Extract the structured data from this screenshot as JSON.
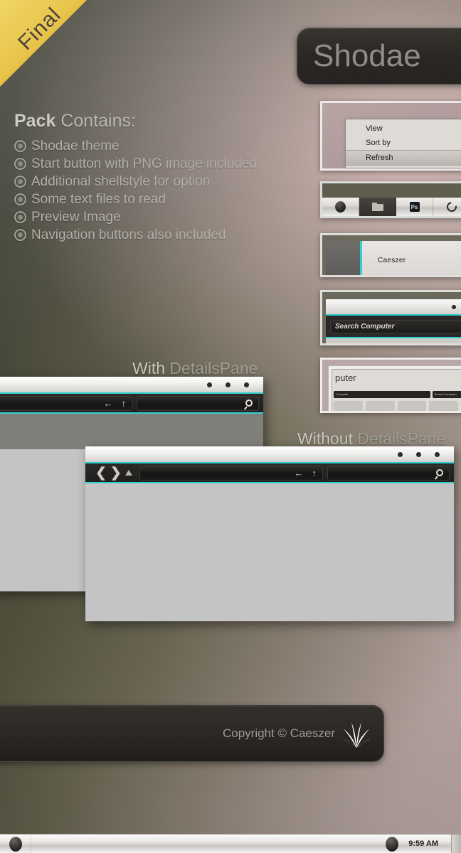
{
  "ribbon": {
    "label": "Final",
    "color": "#e8c54a"
  },
  "title_panel": {
    "text": "Shodae"
  },
  "pack": {
    "heading_bold": "Pack",
    "heading_rest": " Contains:",
    "items": [
      "Shodae theme",
      "Start button with PNG image included",
      "Additional shellstyle for option",
      "Some text files to read",
      "Preview Image",
      "Navigation buttons also included"
    ]
  },
  "section_labels": {
    "with_details_light": "With ",
    "with_details_dark": "DetailsPane",
    "without_details_light": "Without ",
    "without_details_dark": "DetailsPane"
  },
  "context_menu": {
    "items": [
      "View",
      "Sort by",
      "Refresh"
    ],
    "highlighted": "Refresh"
  },
  "taskbar_preview": {
    "buttons": [
      "start-orb",
      "folder",
      "photoshop",
      "firefox"
    ],
    "ps_label": "Ps",
    "active_index": 1
  },
  "user_panel": {
    "name": "Caeszer"
  },
  "search_panel": {
    "placeholder": "Search Computer",
    "dots": 3
  },
  "nested_preview": {
    "title_fragment": "puter",
    "crumb_text": "Computer",
    "search_text": "Search Computer"
  },
  "windows": [
    {
      "id": "with-details-pane",
      "dots": 3,
      "has_details_pane": true,
      "address_value": "",
      "search_value": "",
      "nav_back": "←",
      "nav_up": "↑"
    },
    {
      "id": "without-details-pane",
      "dots": 3,
      "has_details_pane": false,
      "address_value": "",
      "search_value": "",
      "nav_back_chevron": "❮",
      "nav_forward_chevron": "❯",
      "nav_back": "←",
      "nav_up": "↑"
    }
  ],
  "copyright": {
    "text": "Copyright © Caeszer"
  },
  "system_tray": {
    "time": "9:59 AM"
  },
  "accent_colors": {
    "cyan": "#2dd1d1",
    "ribbon_gold": "#e8c54a",
    "panel_dark": "#2a2724",
    "window_body": "#c4c4c4",
    "details_pane": "#807f7c"
  }
}
